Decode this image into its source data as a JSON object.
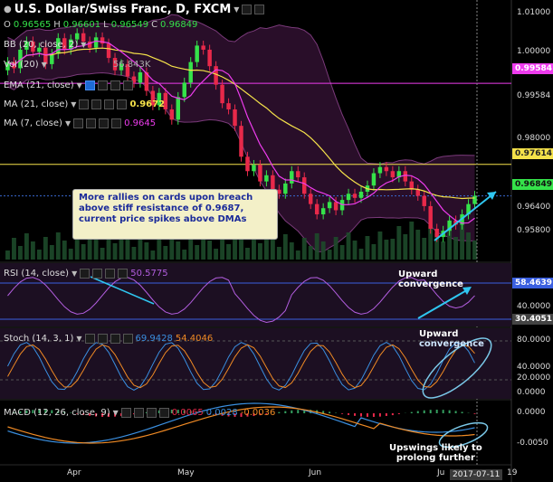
{
  "header": {
    "symbol": "U.S. Dollar/Swiss Franc, D, FXCM",
    "ohlc": {
      "o_label": "O",
      "o": "0.96565",
      "h_label": "H",
      "h": "0.96601",
      "l_label": "L",
      "l": "0.96549",
      "c_label": "C",
      "c": "0.96849"
    }
  },
  "indicators": {
    "bb": {
      "label": "BB (20, close, 2)"
    },
    "vol": {
      "label": "Vol (20)",
      "value": "56.843K"
    },
    "ema": {
      "label": "EMA (21, close)"
    },
    "ma21": {
      "label": "MA (21, close)",
      "value": "0.9672"
    },
    "ma7": {
      "label": "MA (7, close)",
      "value": "0.9645"
    },
    "rsi": {
      "label": "RSI (14, close)",
      "value": "50.5775"
    },
    "stoch": {
      "label": "Stoch (14, 3, 1)",
      "k": "69.9428",
      "d": "54.4046"
    },
    "macd": {
      "label": "MACD (12, 26, close, 9)",
      "hist": "0.0065",
      "macd": "0.0028",
      "signal": "-0.0036"
    }
  },
  "price_axis": {
    "ticks": [
      "1.01000",
      "1.00000",
      "0.99584",
      "0.98000",
      "0.97614",
      "0.96849",
      "0.96400",
      "0.95800"
    ],
    "badges": {
      "pink": "0.99584",
      "yellow": "0.97614",
      "green": "0.96849"
    }
  },
  "rsi_axis": {
    "ticks": [
      "58.4639",
      "40.0000",
      "30.4051"
    ]
  },
  "stoch_axis": {
    "ticks": [
      "80.0000",
      "40.0000",
      "20.0000",
      "0.0000"
    ]
  },
  "macd_axis": {
    "ticks": [
      "0.0000",
      "-0.0050"
    ]
  },
  "time_axis": {
    "ticks": [
      "Apr",
      "May",
      "Jun",
      "Ju"
    ],
    "cursor_date": "2017-07-11",
    "cursor_tail": "19"
  },
  "annotations": {
    "callout": "More rallies on cards upon breach above stiff resistance of 0.9687, current price spikes above DMAs",
    "rsi_note": [
      "Upward",
      "convergence"
    ],
    "stoch_note": [
      "Upward",
      "convergence"
    ],
    "macd_note": [
      "Upswings likely to",
      "prolong further"
    ]
  },
  "colors": {
    "up": "#35e24a",
    "down": "#e8294a",
    "bb_fill": "#4a1a4a",
    "yellow": "#f5e24a",
    "pink": "#ee3cee",
    "blue": "#3a8fe0",
    "cyan": "#2fc6f0"
  },
  "chart_data": {
    "type": "candlestick",
    "title": "U.S. Dollar/Swiss Franc, D, FXCM",
    "ylim": [
      0.955,
      1.013
    ],
    "x": [
      "Apr",
      "May",
      "Jun",
      "Ju"
    ],
    "closes": [
      1.001,
      0.9995,
      1.004,
      1.006,
      1.0035,
      1.0045,
      1.0005,
      1.003,
      1.0068,
      1.004,
      1.0065,
      1.008,
      1.006,
      1.0045,
      1.007,
      1.0055,
      1.002,
      0.999,
      1.0005,
      0.9975,
      0.996,
      0.9985,
      0.994,
      0.9905,
      0.9935,
      0.9895,
      0.987,
      0.9925,
      0.996,
      1.001,
      1.005,
      1.004,
      1.0,
      0.9955,
      0.991,
      0.9895,
      0.9855,
      0.978,
      0.9745,
      0.976,
      0.972,
      0.9735,
      0.97,
      0.969,
      0.9715,
      0.9745,
      0.973,
      0.969,
      0.9665,
      0.964,
      0.9655,
      0.967,
      0.965,
      0.9675,
      0.969,
      0.968,
      0.9695,
      0.971,
      0.974,
      0.9755,
      0.9745,
      0.973,
      0.9745,
      0.972,
      0.97,
      0.9685,
      0.966,
      0.9605,
      0.9585,
      0.96,
      0.9625,
      0.9615,
      0.964,
      0.9665,
      0.9685
    ]
  }
}
